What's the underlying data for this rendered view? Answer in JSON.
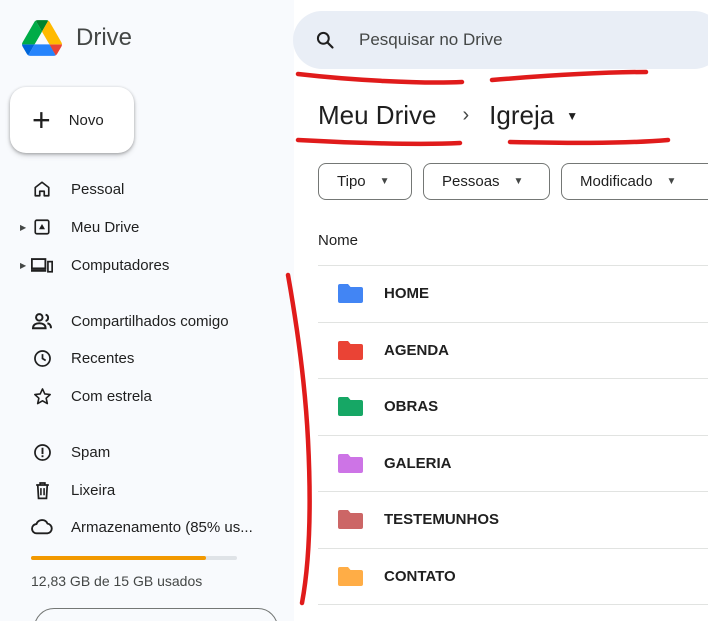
{
  "app": {
    "title": "Drive"
  },
  "sidebar": {
    "new_button": "Novo",
    "items": [
      {
        "label": "Pessoal",
        "icon": "home-icon"
      },
      {
        "label": "Meu Drive",
        "icon": "my-drive-icon"
      },
      {
        "label": "Computadores",
        "icon": "computers-icon"
      },
      {
        "label": "Compartilhados comigo",
        "icon": "people-icon"
      },
      {
        "label": "Recentes",
        "icon": "clock-icon"
      },
      {
        "label": "Com estrela",
        "icon": "star-icon"
      },
      {
        "label": "Spam",
        "icon": "spam-icon"
      },
      {
        "label": "Lixeira",
        "icon": "trash-icon"
      },
      {
        "label": "Armazenamento (85% us...",
        "icon": "cloud-icon"
      }
    ],
    "storage": {
      "used_fraction": 0.85,
      "text": "12,83 GB de 15 GB usados"
    }
  },
  "search": {
    "placeholder": "Pesquisar no Drive"
  },
  "breadcrumb": {
    "root": "Meu Drive",
    "current": "Igreja"
  },
  "filters": {
    "type": "Tipo",
    "people": "Pessoas",
    "modified": "Modificado"
  },
  "list": {
    "header_name": "Nome",
    "folders": [
      {
        "name": "HOME",
        "color": "#4285f4"
      },
      {
        "name": "AGENDA",
        "color": "#ea4335"
      },
      {
        "name": "OBRAS",
        "color": "#16a765"
      },
      {
        "name": "GALERIA",
        "color": "#cd74e6"
      },
      {
        "name": "TESTEMUNHOS",
        "color": "#cc6666"
      },
      {
        "name": "CONTATO",
        "color": "#ffad46"
      }
    ]
  },
  "colors": {
    "annotation_red": "#e01b1b",
    "storage_warning": "#f29900"
  }
}
